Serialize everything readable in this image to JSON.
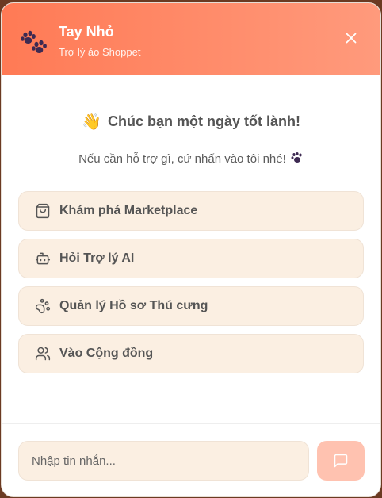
{
  "header": {
    "title": "Tay Nhỏ",
    "subtitle": "Trợ lý ảo Shoppet",
    "logo_icon": "paw-icon",
    "close_icon": "close-icon"
  },
  "welcome": {
    "greeting": "Chúc bạn một ngày tốt lành!",
    "greeting_emoji": "👋",
    "helper": "Nếu cần hỗ trợ gì, cứ nhấn vào tôi nhé!",
    "helper_icon": "paw-icon"
  },
  "options": [
    {
      "label": "Khám phá Marketplace",
      "icon": "shopping-bag-icon"
    },
    {
      "label": "Hỏi Trợ lý AI",
      "icon": "bot-icon"
    },
    {
      "label": "Quản lý Hồ sơ Thú cưng",
      "icon": "paw-icon"
    },
    {
      "label": "Vào Cộng đồng",
      "icon": "users-icon"
    }
  ],
  "composer": {
    "placeholder": "Nhập tin nhắn...",
    "value": "",
    "send_icon": "message-square-icon"
  },
  "colors": {
    "header_start": "#ff7a55",
    "header_end": "#ff9a7c",
    "option_bg": "#fbefe2",
    "send_button_bg": "#ffc2b0",
    "paw_color": "#3d2a52"
  }
}
